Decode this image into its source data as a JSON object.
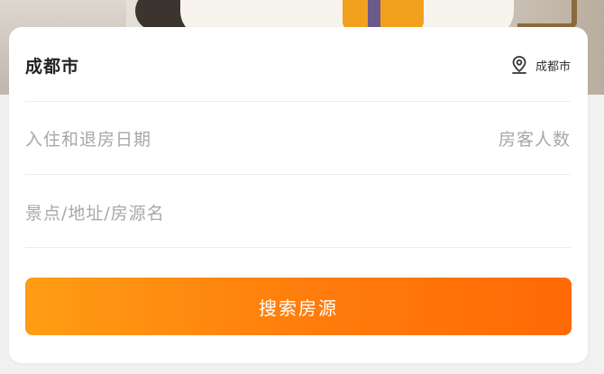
{
  "search_card": {
    "city": "成都市",
    "current_location": "成都市",
    "date_placeholder": "入住和退房日期",
    "guests_placeholder": "房客人数",
    "keyword_placeholder": "景点/地址/房源名",
    "search_button": "搜索房源"
  },
  "colors": {
    "accent_start": "#ff9d14",
    "accent_end": "#ff6a05"
  },
  "icons": {
    "location": "location-pin-icon"
  }
}
